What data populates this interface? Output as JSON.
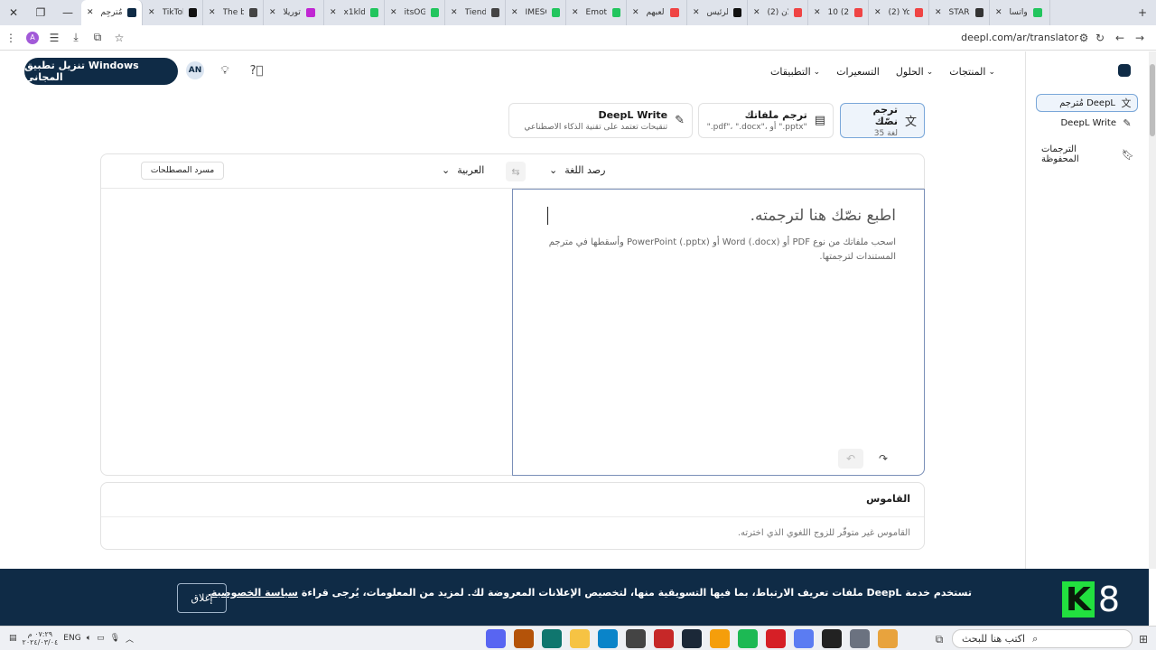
{
  "browser": {
    "tabs": [
      {
        "label": "مُترجِم",
        "color": "#0f2b46",
        "active": true
      },
      {
        "label": "TikTok",
        "color": "#111111"
      },
      {
        "label": "The b",
        "color": "#444444"
      },
      {
        "label": "توريلا",
        "color": "#c026d3"
      },
      {
        "label": "x1kld",
        "color": "#22c55e"
      },
      {
        "label": "itsOG",
        "color": "#22c55e"
      },
      {
        "label": "Tiend",
        "color": "#444444"
      },
      {
        "label": "IMESC",
        "color": "#22c55e"
      },
      {
        "label": "Emoti",
        "color": "#22c55e"
      },
      {
        "label": "لعبهم",
        "color": "#ef4444"
      },
      {
        "label": "الرئيس",
        "color": "#111111"
      },
      {
        "label": "(2) لأن",
        "color": "#ef4444"
      },
      {
        "label": "10 (2)",
        "color": "#ef4444"
      },
      {
        "label": "(2) Yo",
        "color": "#ef4444"
      },
      {
        "label": "STARL",
        "color": "#333333"
      },
      {
        "label": "واتسا",
        "color": "#22c55e"
      }
    ],
    "url": "deepl.com/ar/translator",
    "profile_initial": "A"
  },
  "header": {
    "nav": [
      "المنتجات",
      "الحلول",
      "التسعيرات",
      "التطبيقات"
    ],
    "download_label": "تنزيل تطبيق Windows المجاني",
    "user_initials": "AN"
  },
  "sidebar": {
    "items": [
      {
        "label": "مُترجم DeepL",
        "active": true
      },
      {
        "label": "DeepL Write",
        "active": false
      },
      {
        "label": "الترجمات المحفوظة",
        "active": false
      }
    ]
  },
  "modes": [
    {
      "title": "ترجم نصّك",
      "sub": "35 لغة",
      "active": true
    },
    {
      "title": "ترجم ملفاتك",
      "sub": "\".pdf\"، \".docx\"، أو \".pptx\""
    },
    {
      "title": "DeepL Write",
      "sub": "تنقيحات تعتمد على تقنية الذكاء الاصطناعي"
    }
  ],
  "translator": {
    "source_lang": "رصد اللغة",
    "target_lang": "العربية",
    "glossary_label": "مسرد المصطلحات",
    "placeholder": "اطبع نصّك هنا لترجمته.",
    "hint": "اسحب ملفاتك من نوع PDF أو Word (.docx) أو PowerPoint (.pptx) وأسقطها في مترجم المستندات لترجمتها."
  },
  "dictionary": {
    "title": "القاموس",
    "message": "القاموس غير متوفّر للزوج اللغوي الذي اخترته."
  },
  "cookie": {
    "text": "تستخدم خدمة DeepL ملفات تعريف الارتباط، بما فيها التسويقية منها، لتخصيص الإعلانات المعروضة لك. لمزيد من المعلومات، يُرجى قراءة",
    "link": "سياسة الخصوصية",
    "close_label": "إغلاق",
    "watermark_k": "K",
    "watermark_num": "8"
  },
  "taskbar": {
    "search_placeholder": "اكتب هنا للبحث",
    "lang": "ENG",
    "time": "٠٧:٢٩ م",
    "date": "٢٠٢٤/٠٣/٠٤",
    "apps": [
      {
        "name": "chrome-app-icon",
        "color": "#e8a33d"
      },
      {
        "name": "task-view-icon",
        "color": "#6b7280"
      },
      {
        "name": "epic-app-icon",
        "color": "#222222"
      },
      {
        "name": "telegram-app-icon",
        "color": "#5b7cf2"
      },
      {
        "name": "opera-app-icon",
        "color": "#d61f26"
      },
      {
        "name": "spotify-app-icon",
        "color": "#1db954"
      },
      {
        "name": "files-app-icon",
        "color": "#f59e0b"
      },
      {
        "name": "steam-app-icon",
        "color": "#1b2838"
      },
      {
        "name": "video-app-icon",
        "color": "#c62828"
      },
      {
        "name": "settings-app-icon",
        "color": "#444444"
      },
      {
        "name": "edge-app-icon",
        "color": "#0a84c9"
      },
      {
        "name": "explorer-app-icon",
        "color": "#f6c343"
      },
      {
        "name": "terminal-app-icon",
        "color": "#0f766e"
      },
      {
        "name": "mail-app-icon",
        "color": "#b45309"
      },
      {
        "name": "discord-app-icon",
        "color": "#5865f2"
      }
    ]
  }
}
